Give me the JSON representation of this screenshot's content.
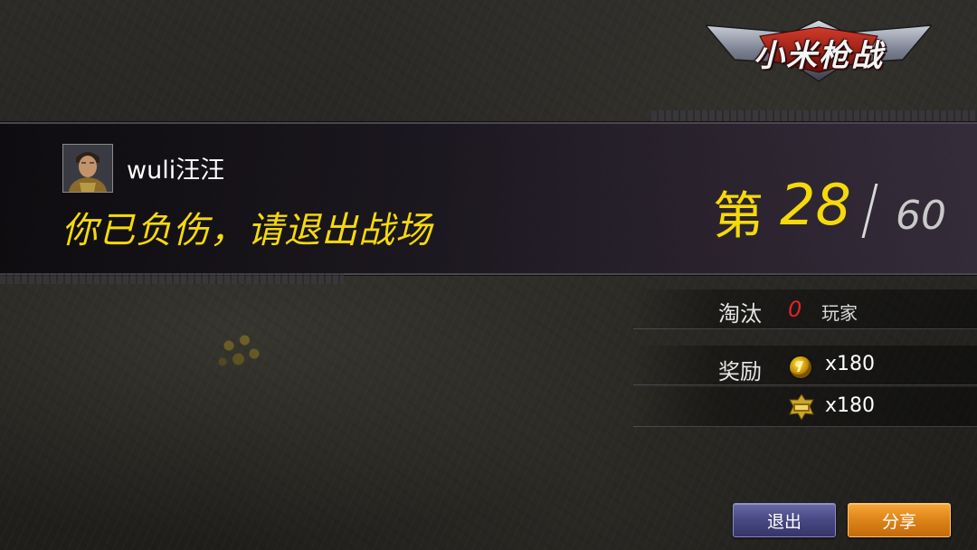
{
  "logo": {
    "text": "小米枪战",
    "icon": "game-logo-emblem"
  },
  "player": {
    "name": "wuli汪汪",
    "avatar_icon": "soldier-portrait",
    "status_message": "你已负伤，请退出战场"
  },
  "rank": {
    "prefix": "第",
    "position": "28",
    "total": "60"
  },
  "stats": {
    "kills_label": "淘汰",
    "kills_value": "0",
    "kills_unit": "玩家",
    "reward_label": "奖励",
    "rewards": [
      {
        "icon": "gold-coin-icon",
        "amount": "x180"
      },
      {
        "icon": "experience-badge-icon",
        "amount": "x180"
      }
    ]
  },
  "buttons": {
    "exit_label": "退出",
    "share_label": "分享"
  },
  "colors": {
    "accent_yellow": "#f6d90b",
    "kills_red": "#e02424",
    "exit_button": "#4a4a86",
    "share_button": "#e0861a"
  }
}
